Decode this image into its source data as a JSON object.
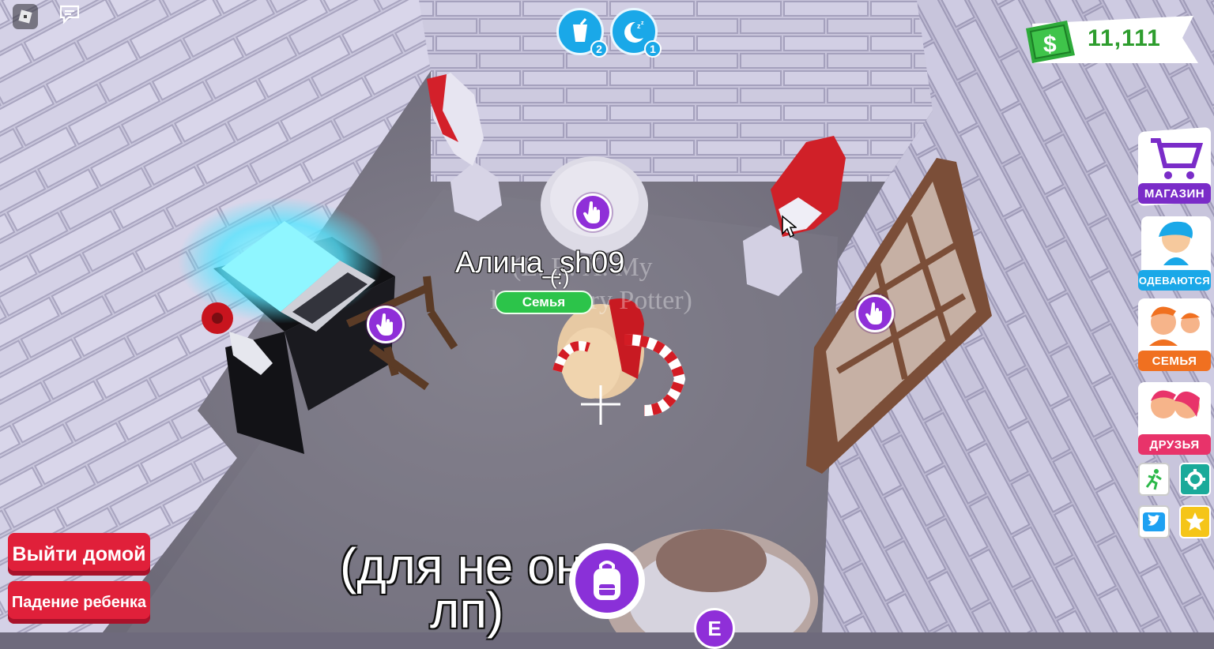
{
  "money": {
    "amount": "11,111",
    "icon": "dollar-bill-icon"
  },
  "needs": [
    {
      "name": "thirst",
      "icon": "drink-icon",
      "count": "2",
      "color": "#1aa8e8"
    },
    {
      "name": "sleep",
      "icon": "moon-sleep-icon",
      "count": "1",
      "color": "#1aa8e8"
    }
  ],
  "side_menu": {
    "shop": "МАГАЗИН",
    "dress": "ОДЕВАЮТСЯ",
    "family": "СЕМЬЯ",
    "friends": "ДРУЗЬЯ"
  },
  "small_buttons": [
    "run-icon",
    "settings-gear-icon",
    "twitter-icon",
    "star-icon"
  ],
  "buttons": {
    "go_home": "Выйти домой",
    "baby_fall": "Падение ребенка"
  },
  "player": {
    "name": "Алина_sh09",
    "sub": "(:)",
    "tag": "Семья",
    "ghost_line1": "(L. R. X. My",
    "ghost_line2": "love. Harry Potter)"
  },
  "chat": {
    "line1": "(для не он",
    "line2": "лп)"
  },
  "prompt_key": "E",
  "colors": {
    "accent_purple": "#8f2fd8",
    "need_blue": "#1aa8e8",
    "family_green": "#2cc44a",
    "red_button": "#e0203a",
    "money_green": "#2e9d2e"
  }
}
